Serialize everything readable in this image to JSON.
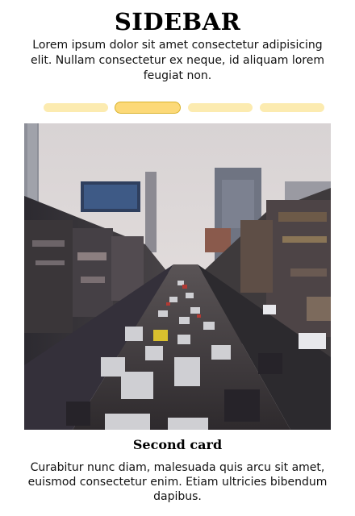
{
  "sidebar": {
    "title": "SIDEBAR",
    "intro": "Lorem ipsum dolor sit amet consectetur adipisicing elit. Nullam consectetur ex neque, id aliquam lorem feugiat non.",
    "carousel": {
      "active_index": 1,
      "slide_count": 4,
      "dot_color": "#fcebb0",
      "active_dot_color": "#fcd978"
    },
    "card": {
      "image": "city-street-traffic-photo",
      "title": "Second card",
      "text": "Curabitur nunc diam, malesuada quis arcu sit amet, euismod consectetur enim. Etiam ultricies bibendum dapibus."
    }
  }
}
